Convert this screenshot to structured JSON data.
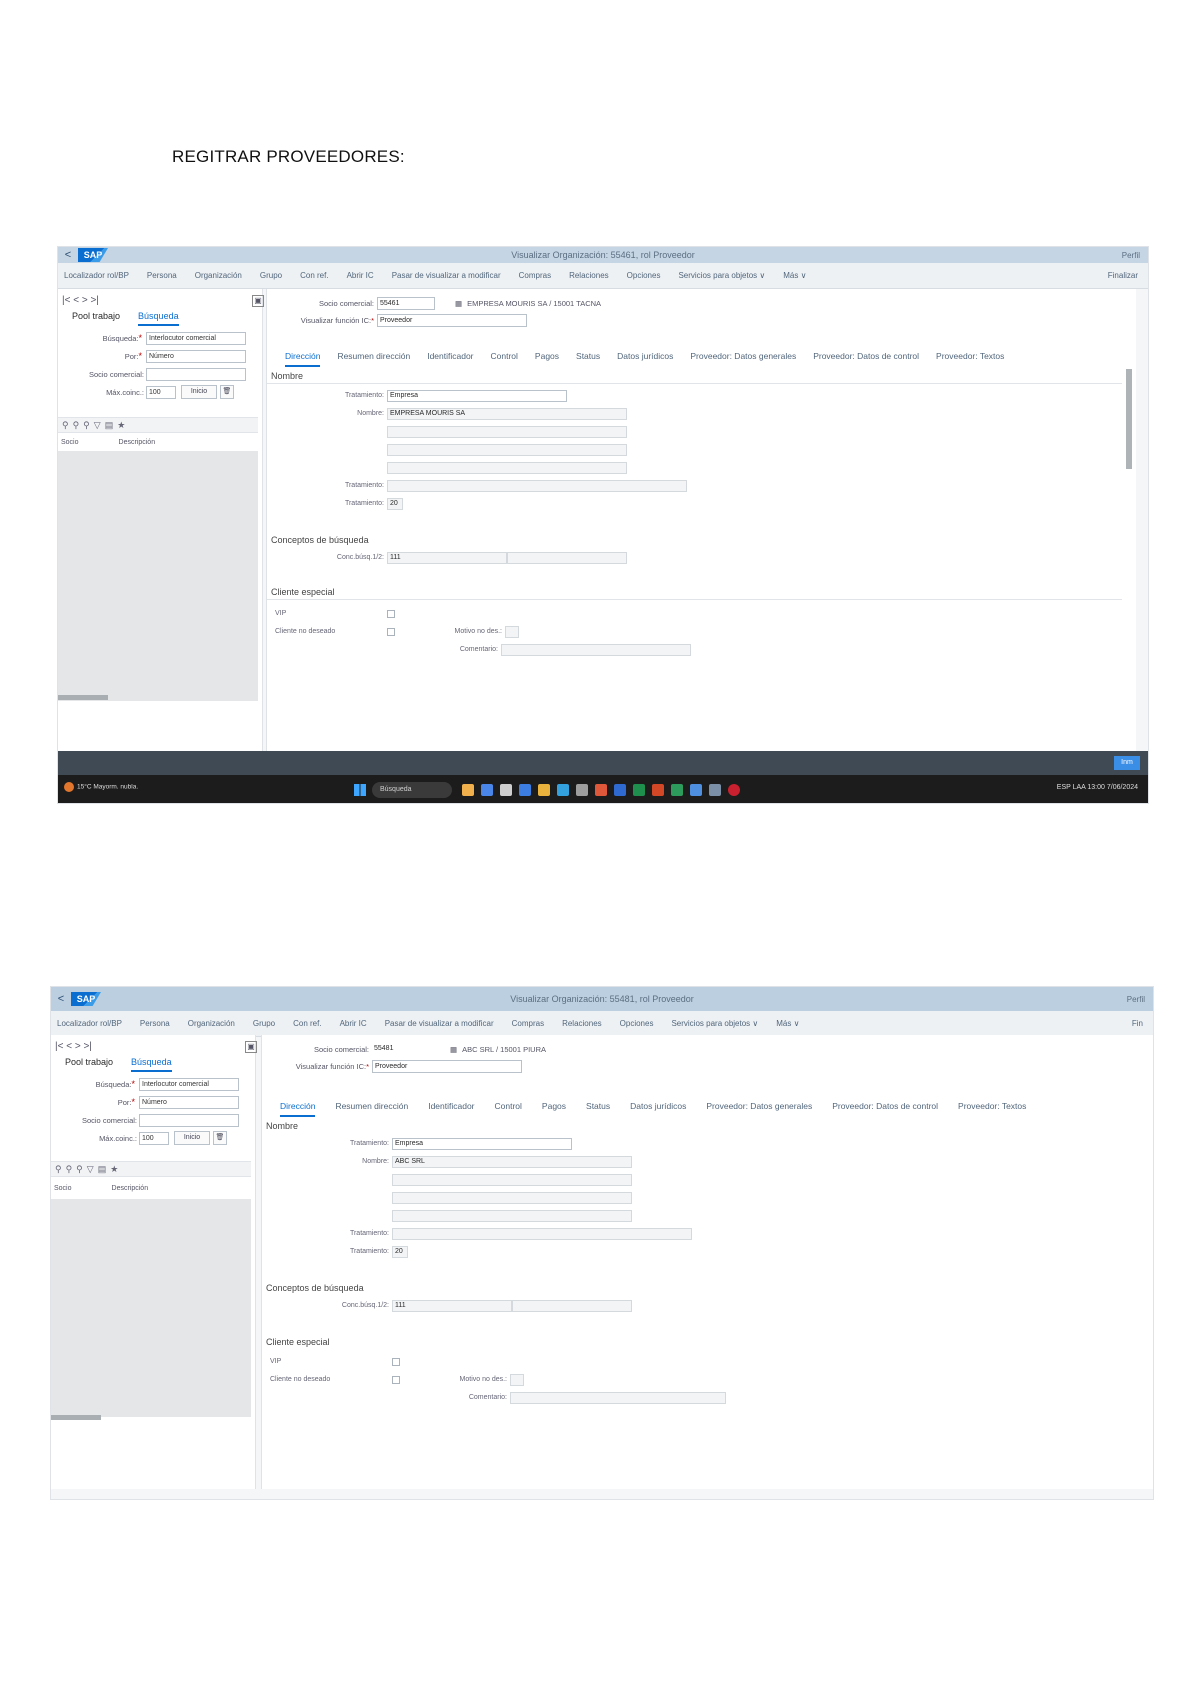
{
  "document": {
    "title": "REGITRAR PROVEEDORES:"
  },
  "screenshot1": {
    "shell_title": "Visualizar Organización: 55461, rol Proveedor",
    "user": "Perfil",
    "toolbar": [
      "Localizador rol/BP",
      "Persona",
      "Organización",
      "Grupo",
      "Con ref.",
      "Abrir IC",
      "Pasar de visualizar a modificar",
      "Compras",
      "Relaciones",
      "Opciones",
      "Servicios para objetos ∨",
      "Más ∨"
    ],
    "toolbar_end": "Finalizar",
    "nav_arrows": "|< < > >|",
    "left_tabs": [
      "Pool trabajo",
      "Búsqueda"
    ],
    "search": {
      "busqueda_label": "Búsqueda:",
      "busqueda_value": "Interlocutor comercial",
      "por_label": "Por:",
      "por_value": "Número",
      "socio_label": "Socio comercial:",
      "socio_value": "",
      "max_label": "Máx.coinc.:",
      "max_value": "100",
      "inicio": "Inicio"
    },
    "list_cols": [
      "Socio",
      "Descripción"
    ],
    "header": {
      "socio_label": "Socio comercial:",
      "socio_value": "55461",
      "socio_desc": "EMPRESA MOURIS SA / 15001 TACNA",
      "rol_label": "Visualizar función IC:",
      "rol_value": "Proveedor"
    },
    "tabs": [
      "Dirección",
      "Resumen dirección",
      "Identificador",
      "Control",
      "Pagos",
      "Status",
      "Datos jurídicos",
      "Proveedor: Datos generales",
      "Proveedor: Datos de control",
      "Proveedor: Textos"
    ],
    "sections": {
      "nombre": "Nombre",
      "conceptos": "Conceptos de búsqueda",
      "cliente": "Cliente especial"
    },
    "fields": {
      "trat_label": "Tratamiento:",
      "trat_value": "Empresa",
      "nombre_label": "Nombre:",
      "nombre_value": "EMPRESA MOURIS SA",
      "trat2_label": "Tratamiento:",
      "trat3_label": "Tratamiento:",
      "trat3_value": "20",
      "conc_label": "Conc.búsq.1/2:",
      "conc_value": "111",
      "vip_label": "VIP",
      "nodeseado_label": "Cliente no deseado",
      "motivo_label": "Motivo no des.:",
      "comentario_label": "Comentario:"
    },
    "footer_button": "Inm",
    "taskbar": {
      "weather": "15°C Mayorm. nubla.",
      "search": "Búsqueda",
      "tray": "ESP LAA 13:00 7/06/2024"
    }
  },
  "screenshot2": {
    "shell_title": "Visualizar Organización: 55481, rol Proveedor",
    "user": "Perfil",
    "toolbar": [
      "Localizador rol/BP",
      "Persona",
      "Organización",
      "Grupo",
      "Con ref.",
      "Abrir IC",
      "Pasar de visualizar a modificar",
      "Compras",
      "Relaciones",
      "Opciones",
      "Servicios para objetos ∨",
      "Más ∨"
    ],
    "toolbar_end": "Fin",
    "nav_arrows": "|< < > >|",
    "left_tabs": [
      "Pool trabajo",
      "Búsqueda"
    ],
    "search": {
      "busqueda_label": "Búsqueda:",
      "busqueda_value": "Interlocutor comercial",
      "por_label": "Por:",
      "por_value": "Número",
      "socio_label": "Socio comercial:",
      "socio_value": "",
      "max_label": "Máx.coinc.:",
      "max_value": "100",
      "inicio": "Inicio"
    },
    "list_cols": [
      "Socio",
      "Descripción"
    ],
    "header": {
      "socio_label": "Socio comercial:",
      "socio_value": "55481",
      "socio_desc": "ABC SRL / 15001 PIURA",
      "rol_label": "Visualizar función IC:",
      "rol_value": "Proveedor"
    },
    "tabs": [
      "Dirección",
      "Resumen dirección",
      "Identificador",
      "Control",
      "Pagos",
      "Status",
      "Datos jurídicos",
      "Proveedor: Datos generales",
      "Proveedor: Datos de control",
      "Proveedor: Textos"
    ],
    "sections": {
      "nombre": "Nombre",
      "conceptos": "Conceptos de búsqueda",
      "cliente": "Cliente especial"
    },
    "fields": {
      "trat_label": "Tratamiento:",
      "trat_value": "Empresa",
      "nombre_label": "Nombre:",
      "nombre_value": "ABC SRL",
      "trat2_label": "Tratamiento:",
      "trat3_label": "Tratamiento:",
      "trat3_value": "20",
      "conc_label": "Conc.búsq.1/2:",
      "conc_value": "111",
      "vip_label": "VIP",
      "nodeseado_label": "Cliente no deseado",
      "motivo_label": "Motivo no des.:",
      "comentario_label": "Comentario:"
    }
  }
}
